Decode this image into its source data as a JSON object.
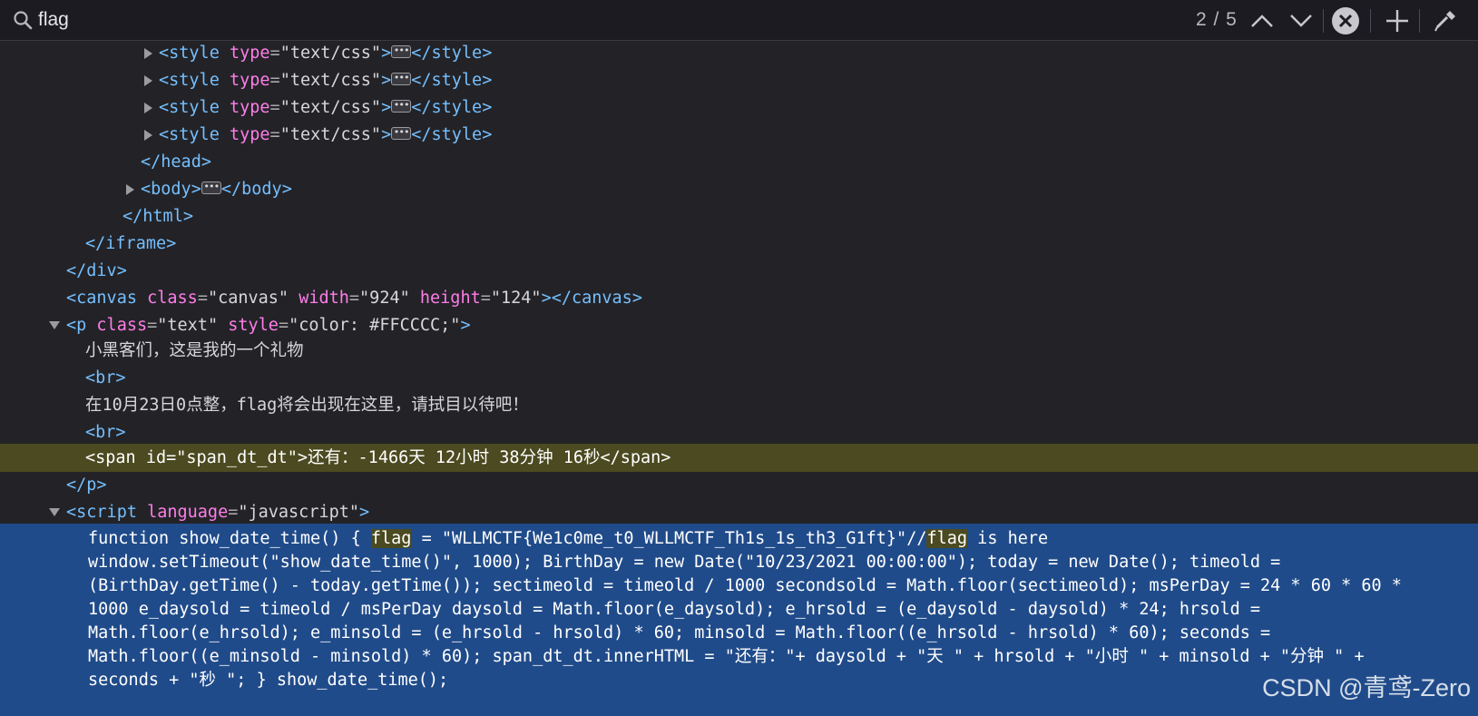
{
  "search": {
    "value": "flag",
    "match_count": "2 / 5",
    "icons": [
      "search-icon",
      "chevron-up-icon",
      "chevron-down-icon",
      "close-circle-icon",
      "plus-icon",
      "eyedropper-icon"
    ]
  },
  "tree": {
    "style_tag": "style",
    "type_attr": "type",
    "type_val": "\"text/css\"",
    "ellipsis": "•••",
    "head_close": "</head>",
    "body_tag": "body",
    "html_close": "</html>",
    "iframe_close": "iframe",
    "div_close": "div",
    "canvas": {
      "tag": "canvas",
      "class_attr": "class",
      "class_val": "\"canvas\"",
      "width_attr": "width",
      "width_val": "\"924\"",
      "height_attr": "height",
      "height_val": "\"124\""
    },
    "p": {
      "tag": "p",
      "class_attr": "class",
      "class_val": "\"text\"",
      "style_attr": "style",
      "style_val": "\"color: #FFCCCC;\""
    },
    "text1": "小黑客们，这是我的一个礼物",
    "br": "br",
    "text2": "在10月23日0点整，flag将会出现在这里，请拭目以待吧！",
    "span_open": "<span id=\"span_dt_dt\">",
    "span_text": "还有：-1466天 12小时 38分钟 16秒",
    "span_close": "</span>",
    "p_close": "p",
    "script": {
      "tag": "script",
      "lang_attr": "language",
      "lang_val": "\"javascript\""
    }
  },
  "script_content": {
    "l1_a": "function show_date_time() { ",
    "l1_flag1": "flag",
    "l1_b": " = \"WLLMCTF{We1c0me_t0_WLLMCTF_Th1s_1s_th3_G1ft}\"//",
    "l1_flag2": "flag",
    "l1_c": " is here",
    "l2": "window.setTimeout(\"show_date_time()\", 1000); BirthDay = new Date(\"10/23/2021 00:00:00\"); today = new Date(); timeold =",
    "l3": "(BirthDay.getTime() - today.getTime()); sectimeold = timeold / 1000 secondsold = Math.floor(sectimeold); msPerDay = 24 * 60 * 60 *",
    "l4": "1000 e_daysold = timeold / msPerDay daysold = Math.floor(e_daysold); e_hrsold = (e_daysold - daysold) * 24; hrsold =",
    "l5": "Math.floor(e_hrsold); e_minsold = (e_hrsold - hrsold) * 60; minsold = Math.floor((e_hrsold - hrsold) * 60); seconds =",
    "l6": "Math.floor((e_minsold - minsold) * 60); span_dt_dt.innerHTML = \"还有：\"+ daysold + \"天 \" + hrsold + \"小时 \" + minsold + \"分钟 \" +",
    "l7": "seconds + \"秒 \"; } show_date_time();"
  },
  "watermark": "CSDN @青鸢-Zero",
  "colors": {
    "background": "#232327",
    "tag": "#75bfff",
    "attr": "#ff7de9",
    "highlight_row": "#4b4a20",
    "selected_block": "#204b8a"
  }
}
